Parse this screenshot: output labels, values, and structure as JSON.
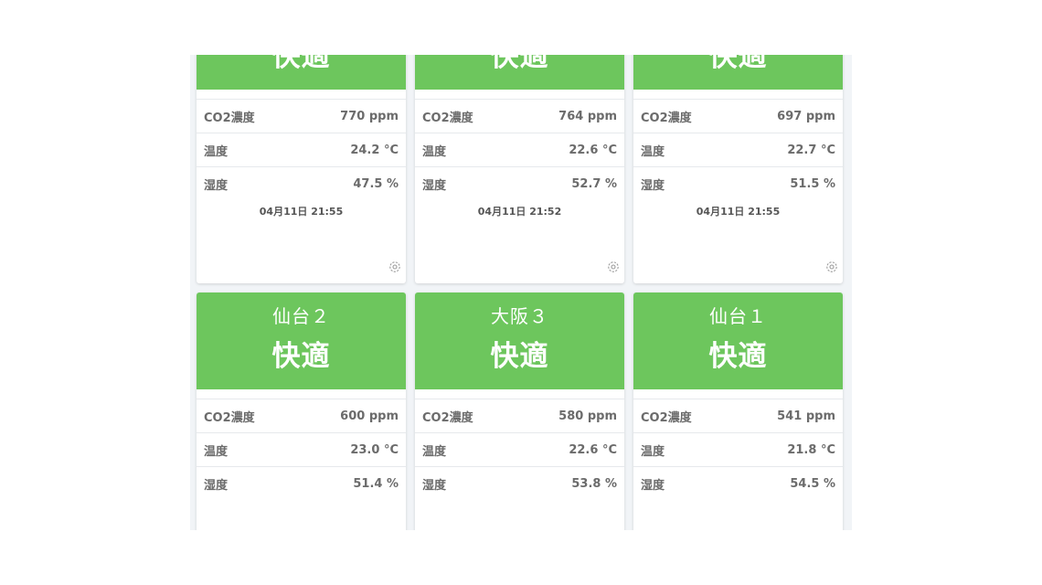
{
  "cards": [
    {
      "name": "",
      "status": "快適",
      "co2_label": "CO2濃度",
      "co2": "770 ppm",
      "temp_label": "温度",
      "temp": "24.2 °C",
      "hum_label": "湿度",
      "hum": "47.5 %",
      "time": "04月11日 21:55"
    },
    {
      "name": "",
      "status": "快適",
      "co2_label": "CO2濃度",
      "co2": "764 ppm",
      "temp_label": "温度",
      "temp": "22.6 °C",
      "hum_label": "湿度",
      "hum": "52.7 %",
      "time": "04月11日 21:52"
    },
    {
      "name": "",
      "status": "快適",
      "co2_label": "CO2濃度",
      "co2": "697 ppm",
      "temp_label": "温度",
      "temp": "22.7 °C",
      "hum_label": "湿度",
      "hum": "51.5 %",
      "time": "04月11日 21:55"
    },
    {
      "name": "仙台２",
      "status": "快適",
      "co2_label": "CO2濃度",
      "co2": "600 ppm",
      "temp_label": "温度",
      "temp": "23.0 °C",
      "hum_label": "湿度",
      "hum": "51.4 %",
      "time": ""
    },
    {
      "name": "大阪３",
      "status": "快適",
      "co2_label": "CO2濃度",
      "co2": "580 ppm",
      "temp_label": "温度",
      "temp": "22.6 °C",
      "hum_label": "湿度",
      "hum": "53.8 %",
      "time": ""
    },
    {
      "name": "仙台１",
      "status": "快適",
      "co2_label": "CO2濃度",
      "co2": "541 ppm",
      "temp_label": "温度",
      "temp": "21.8 °C",
      "hum_label": "湿度",
      "hum": "54.5 %",
      "time": ""
    }
  ],
  "colors": {
    "status_ok": "#6dc65d"
  },
  "icons": {
    "settings": "gear-icon"
  }
}
